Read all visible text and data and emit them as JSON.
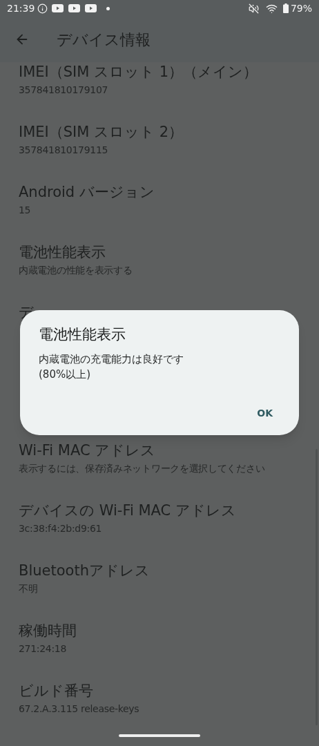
{
  "status_bar": {
    "time": "21:39",
    "battery": "79%"
  },
  "app_bar": {
    "title": "デバイス情報"
  },
  "items": [
    {
      "title": "IMEI（SIM スロット 1）（メイン）",
      "value": "357841810179107"
    },
    {
      "title": "IMEI（SIM スロット 2）",
      "value": "357841810179115"
    },
    {
      "title": "Android バージョン",
      "value": "15"
    },
    {
      "title": "電池性能表示",
      "value": "内蔵電池の性能を表示する"
    },
    {
      "title": "デ",
      "kind": "covered"
    },
    {
      "title": "Wi-Fi MAC アドレス",
      "value": "表示するには、保存済みネットワークを選択してください"
    },
    {
      "title": "デバイスの Wi-Fi MAC アドレス",
      "value": "3c:38:f4:2b:d9:61"
    },
    {
      "title": "Bluetoothアドレス",
      "value": "不明"
    },
    {
      "title": "稼働時間",
      "value": "271:24:18"
    },
    {
      "title": "ビルド番号",
      "value": "67.2.A.3.115 release-keys"
    }
  ],
  "dialog": {
    "title": "電池性能表示",
    "message": "内蔵電池の充電能力は良好です\n(80%以上)",
    "button": "OK"
  }
}
